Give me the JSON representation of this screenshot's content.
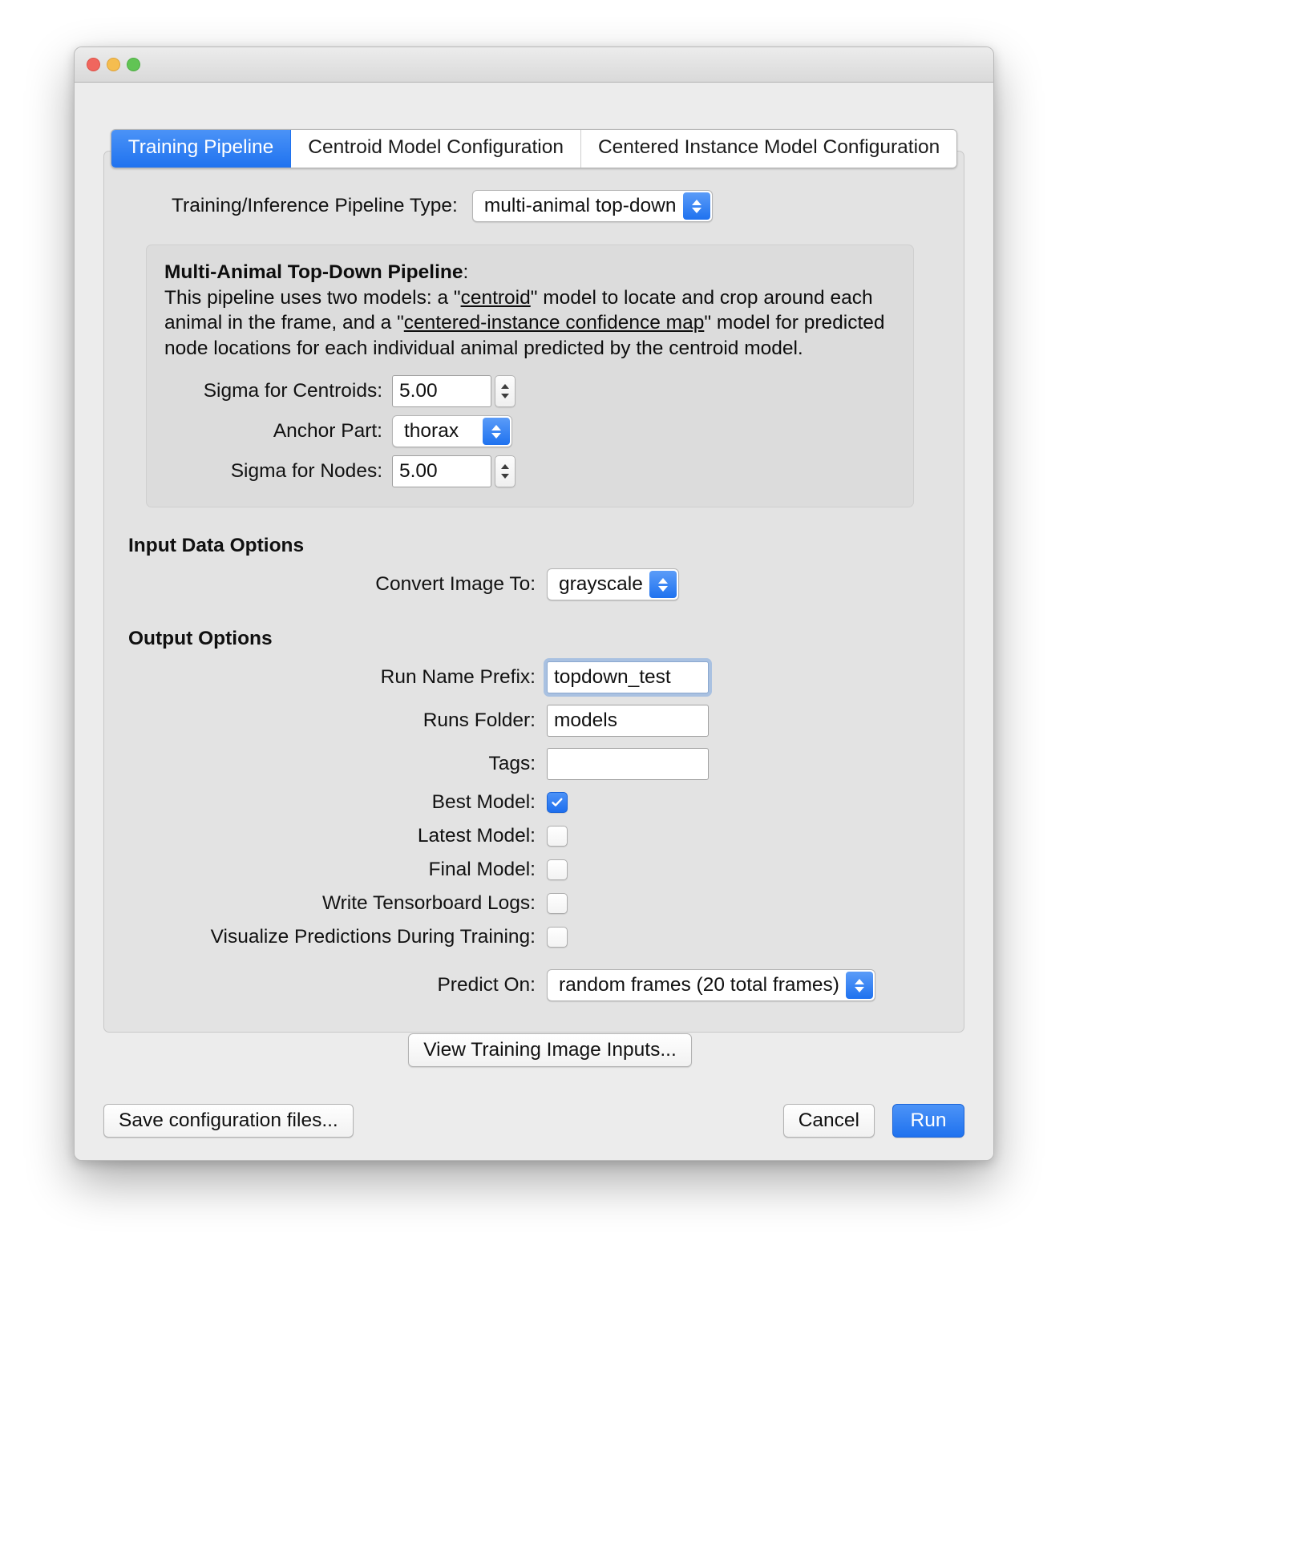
{
  "window": {
    "traffic_lights": [
      "close",
      "minimize",
      "zoom"
    ]
  },
  "tabs": [
    {
      "label": "Training Pipeline",
      "active": true
    },
    {
      "label": "Centroid Model Configuration",
      "active": false
    },
    {
      "label": "Centered Instance Model Configuration",
      "active": false
    }
  ],
  "pipeline": {
    "type_label": "Training/Inference Pipeline Type:",
    "type_value": "multi-animal top-down"
  },
  "description": {
    "title": "Multi-Animal Top-Down Pipeline",
    "title_colon": ":",
    "line1_a": "This pipeline uses two models: a \"",
    "line1_link": "centroid",
    "line1_b": "\" model to locate and crop around each animal in the frame, and a \"",
    "line2_link": "centered-instance confidence map",
    "line2_b": "\" model for predicted node locations for each individual animal predicted by the centroid model."
  },
  "sigma_centroids": {
    "label": "Sigma for Centroids:",
    "value": "5.00"
  },
  "anchor_part": {
    "label": "Anchor Part:",
    "value": "thorax"
  },
  "sigma_nodes": {
    "label": "Sigma for Nodes:",
    "value": "5.00"
  },
  "input_data": {
    "heading": "Input Data Options",
    "convert_label": "Convert Image To:",
    "convert_value": "grayscale"
  },
  "output": {
    "heading": "Output Options",
    "run_name_prefix": {
      "label": "Run Name Prefix:",
      "value": "topdown_test",
      "placeholder": ""
    },
    "runs_folder": {
      "label": "Runs Folder:",
      "value": "models",
      "placeholder": ""
    },
    "tags": {
      "label": "Tags:",
      "value": "",
      "placeholder": ""
    },
    "best_model": {
      "label": "Best Model:",
      "checked": true
    },
    "latest_model": {
      "label": "Latest Model:",
      "checked": false
    },
    "final_model": {
      "label": "Final Model:",
      "checked": false
    },
    "tensorboard": {
      "label": "Write Tensorboard Logs:",
      "checked": false
    },
    "visualize": {
      "label": "Visualize Predictions During Training:",
      "checked": false
    },
    "predict_on": {
      "label": "Predict On:",
      "value": "random frames (20 total frames)"
    },
    "view_inputs_button": "View Training Image Inputs..."
  },
  "footer": {
    "save_config": "Save configuration files...",
    "cancel": "Cancel",
    "run": "Run"
  },
  "colors": {
    "accent_blue": "#1f72ef",
    "window_bg": "#ececec",
    "panel_bg": "#e3e3e3",
    "desc_bg": "#dcdcdc"
  }
}
